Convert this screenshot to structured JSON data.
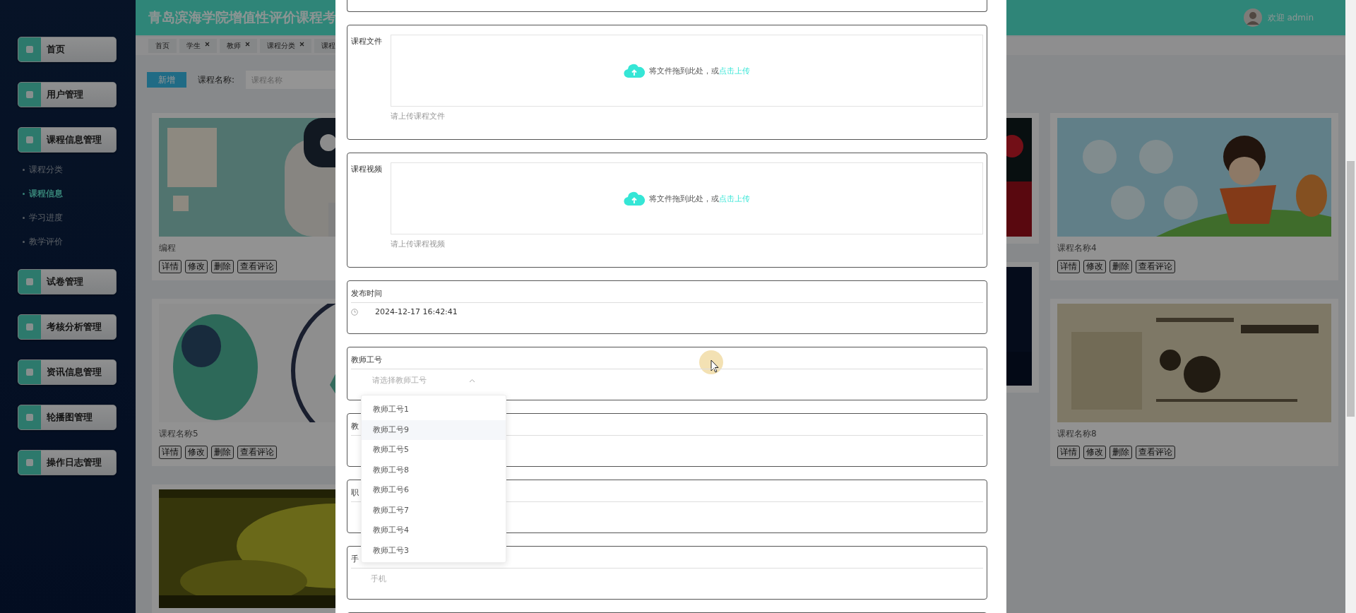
{
  "header": {
    "title": "青岛滨海学院增值性评价课程考",
    "user": "欢迎 admin"
  },
  "menu": [
    {
      "label": "首页"
    },
    {
      "label": "用户管理"
    },
    {
      "label": "课程信息管理",
      "children": [
        {
          "label": "课程分类",
          "selected": false
        },
        {
          "label": "课程信息",
          "selected": true
        },
        {
          "label": "学习进度",
          "selected": false
        },
        {
          "label": "教学评价",
          "selected": false
        }
      ]
    },
    {
      "label": "试卷管理"
    },
    {
      "label": "考核分析管理"
    },
    {
      "label": "资讯信息管理"
    },
    {
      "label": "轮播图管理"
    },
    {
      "label": "操作日志管理"
    }
  ],
  "tabs": [
    {
      "label": "首页",
      "closable": false
    },
    {
      "label": "学生",
      "closable": true
    },
    {
      "label": "教师",
      "closable": true
    },
    {
      "label": "课程分类",
      "closable": true
    },
    {
      "label": "课程",
      "closable": false
    }
  ],
  "toolbar": {
    "add_button": "新增",
    "search_label": "课程名称:",
    "search_placeholder": "课程名称"
  },
  "card_columns": [
    {
      "cards": [
        {
          "kind": "course",
          "title": "编程",
          "actions": [
            "详情",
            "修改",
            "删除",
            "查看评论"
          ]
        },
        {
          "kind": "course",
          "title": "课程名称5",
          "actions": [
            "详情",
            "修改",
            "删除",
            "查看评论"
          ]
        },
        {
          "kind": "picture_only"
        }
      ]
    },
    {
      "cards": [
        {
          "kind": "picture_only"
        },
        {
          "kind": "picture_only"
        }
      ]
    },
    {
      "cards": [
        {
          "kind": "course",
          "title": "课程名称4",
          "actions": [
            "详情",
            "修改",
            "删除",
            "查看评论"
          ]
        },
        {
          "kind": "course",
          "title": "课程名称8",
          "actions": [
            "详情",
            "修改",
            "删除",
            "查看评论"
          ]
        }
      ]
    }
  ],
  "form": [
    {
      "kind": "blank"
    },
    {
      "kind": "upload",
      "label": "课程文件",
      "prompt": "将文件拖到此处，或",
      "link": "点击上传",
      "hint": "请上传课程文件"
    },
    {
      "kind": "upload",
      "label": "课程视频",
      "prompt": "将文件拖到此处，或",
      "link": "点击上传",
      "hint": "请上传课程视频"
    },
    {
      "kind": "datetime",
      "label": "发布时间",
      "value": "2024-12-17 16:42:41"
    },
    {
      "kind": "select",
      "label": "教师工号",
      "placeholder": "请选择教师工号",
      "open": true,
      "options": [
        {
          "label": "教师工号1",
          "highlighted": false
        },
        {
          "label": "教师工号9",
          "highlighted": true
        },
        {
          "label": "教师工号5",
          "highlighted": false
        },
        {
          "label": "教师工号8",
          "highlighted": false
        },
        {
          "label": "教师工号6",
          "highlighted": false
        },
        {
          "label": "教师工号7",
          "highlighted": false
        },
        {
          "label": "教师工号4",
          "highlighted": false
        },
        {
          "label": "教师工号3",
          "highlighted": false
        }
      ]
    },
    {
      "kind": "text",
      "label": "教"
    },
    {
      "kind": "text",
      "label": "职"
    },
    {
      "kind": "text",
      "label": "手",
      "placeholder": "手机"
    },
    {
      "kind": "blank"
    }
  ]
}
